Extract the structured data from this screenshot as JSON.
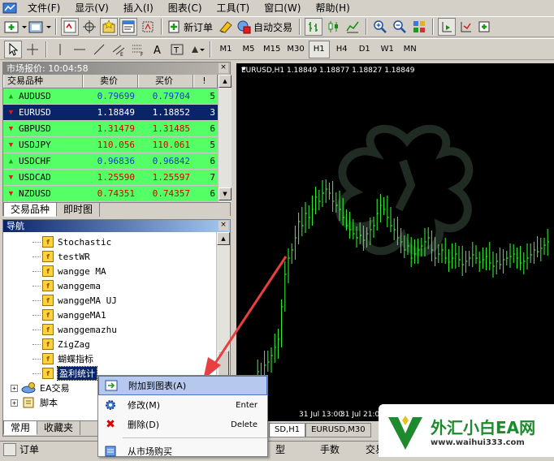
{
  "menu": [
    "文件(F)",
    "显示(V)",
    "插入(I)",
    "图表(C)",
    "工具(T)",
    "窗口(W)",
    "帮助(H)"
  ],
  "toolbar1": {
    "new_order": "新订单",
    "auto_trade": "自动交易"
  },
  "periods": [
    "M1",
    "M5",
    "M15",
    "M30",
    "H1",
    "H4",
    "D1",
    "W1",
    "MN"
  ],
  "active_period": "H1",
  "market_watch": {
    "title": "市场报价: 10:04:58",
    "columns": [
      "交易品种",
      "卖价",
      "买价",
      "!"
    ],
    "rows": [
      {
        "symbol": "AUDUSD",
        "bid": "0.79699",
        "ask": "0.79704",
        "spread": "5",
        "dir": "up",
        "color": "blue"
      },
      {
        "symbol": "EURUSD",
        "bid": "1.18849",
        "ask": "1.18852",
        "spread": "3",
        "dir": "down",
        "color": "blue"
      },
      {
        "symbol": "GBPUSD",
        "bid": "1.31479",
        "ask": "1.31485",
        "spread": "6",
        "dir": "down",
        "color": "red"
      },
      {
        "symbol": "USDJPY",
        "bid": "110.056",
        "ask": "110.061",
        "spread": "5",
        "dir": "down",
        "color": "red"
      },
      {
        "symbol": "USDCHF",
        "bid": "0.96836",
        "ask": "0.96842",
        "spread": "6",
        "dir": "up",
        "color": "blue"
      },
      {
        "symbol": "USDCAD",
        "bid": "1.25590",
        "ask": "1.25597",
        "spread": "7",
        "dir": "down",
        "color": "red"
      },
      {
        "symbol": "NZDUSD",
        "bid": "0.74351",
        "ask": "0.74357",
        "spread": "6",
        "dir": "down",
        "color": "red"
      }
    ],
    "tabs": [
      "交易品种",
      "即时图"
    ]
  },
  "navigator": {
    "title": "导航",
    "indicators": [
      "Stochastic",
      "testWR",
      "wangge MA",
      "wanggema",
      "wanggeMA UJ",
      "wanggeMA1",
      "wanggemazhu",
      "ZigZag",
      "蝴蝶指标",
      "盈利统计"
    ],
    "folders": [
      "EA交易",
      "脚本"
    ],
    "tabs": [
      "常用",
      "收藏夹"
    ]
  },
  "chart": {
    "header": "EURUSD,H1  1.18849 1.18877 1.18827 1.18849",
    "time_labels": [
      "31 Jul 13:00",
      "31 Jul 21:00"
    ],
    "tabs": [
      "SD,H1",
      "EURUSD,M30"
    ]
  },
  "context_menu": [
    {
      "label": "附加到图表(A)",
      "shortcut": "",
      "icon": "attach-icon"
    },
    {
      "label": "修改(M)",
      "shortcut": "Enter",
      "icon": "gear-icon"
    },
    {
      "label": "删除(D)",
      "shortcut": "Delete",
      "icon": "delete-icon"
    },
    {
      "label": "从市场购买",
      "shortcut": "",
      "icon": "market-icon"
    }
  ],
  "bottom_tabs": [
    "订单",
    "型",
    "手数",
    "交易品种"
  ],
  "watermark": {
    "brand": "外汇小白EA网",
    "url": "www.waihui333.com"
  },
  "colors": {
    "market_bg": "#55ff66",
    "selected_row": "#0a246a",
    "candle": "#33ff33",
    "arrow": "#e84040"
  }
}
